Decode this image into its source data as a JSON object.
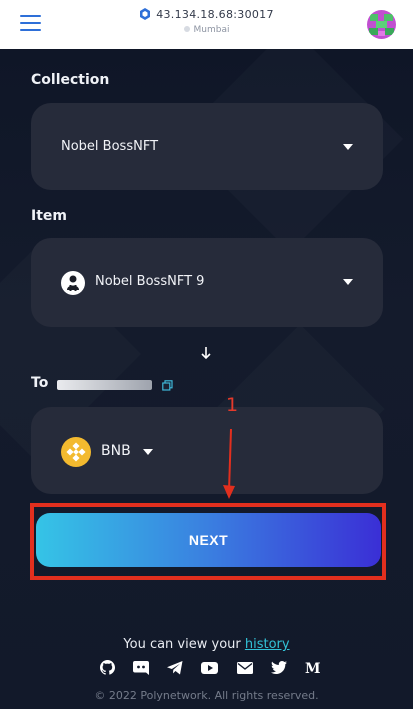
{
  "header": {
    "node_address": "43.134.18.68:30017",
    "node_location": "Mumbai"
  },
  "form": {
    "collection_label": "Collection",
    "collection_value": "Nobel BossNFT",
    "item_label": "Item",
    "item_value": "Nobel BossNFT 9",
    "to_label": "To",
    "chain_value": "BNB",
    "next_label": "NEXT"
  },
  "annotation": {
    "step_number": "1",
    "highlight_color": "#e22f1e"
  },
  "footer": {
    "history_prefix": "You can view your",
    "history_link": "history",
    "social_icons": [
      "github-icon",
      "discord-icon",
      "telegram-icon",
      "youtube-icon",
      "mail-icon",
      "twitter-icon",
      "medium-icon"
    ],
    "copyright": "© 2022 Polynetwork. All rights reserved."
  },
  "colors": {
    "accent_link": "#32c2d7",
    "button_gradient_start": "#35c4e6",
    "button_gradient_end": "#3a2fd6",
    "bnb": "#f3ba2f"
  }
}
